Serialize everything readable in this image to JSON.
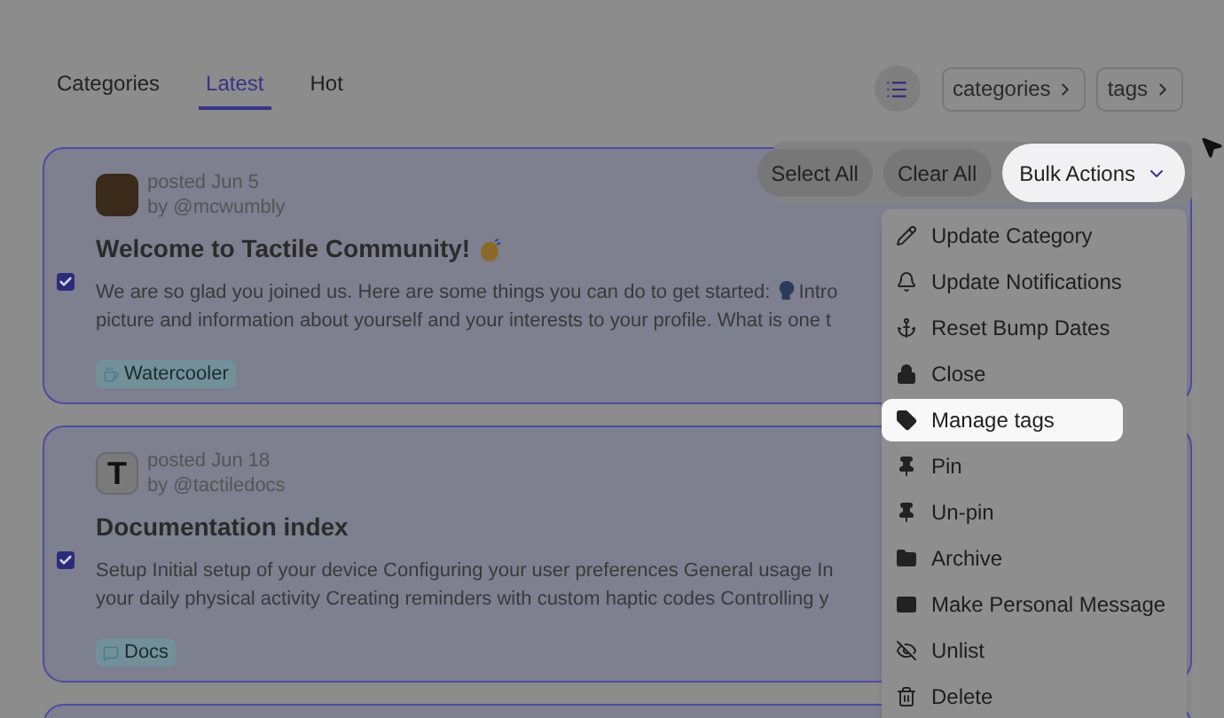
{
  "tabs": [
    {
      "label": "Categories",
      "selected": false
    },
    {
      "label": "Latest",
      "selected": true
    },
    {
      "label": "Hot",
      "selected": false
    }
  ],
  "breadcrumbs": [
    "categories",
    "tags"
  ],
  "bulk_bar": {
    "buttons": [
      {
        "label": "Select All",
        "highlighted": false
      },
      {
        "label": "Clear All",
        "highlighted": false
      },
      {
        "label": "Bulk Actions",
        "highlighted": true,
        "kind": "dropdown"
      }
    ]
  },
  "topics": [
    {
      "posted": "posted Jun 5",
      "author": "by @mcwumbly",
      "avatar": {
        "kind": "photo"
      },
      "title": "Welcome to Tactile Community!",
      "body": [
        "We are so glad you joined us. Here are some things you can do to get started:",
        "Intro\npicture and information about yourself and your interests to your profile. What is one t"
      ],
      "checked": true,
      "tag": {
        "label": "Watercooler"
      }
    },
    {
      "posted": "posted Jun 18",
      "author": "by @tactiledocs",
      "avatar": {
        "kind": "letter",
        "text": "T"
      },
      "title": "Documentation index",
      "body": [
        "Setup Initial setup of your device Configuring your user preferences General usage In\nyour daily physical activity Creating reminders with custom haptic codes Controlling y"
      ],
      "checked": true,
      "tag": {
        "label": "Docs"
      }
    }
  ],
  "bulk_menu": [
    {
      "kind": "pencil",
      "label": "Update Category",
      "highlighted": false
    },
    {
      "kind": "bell",
      "label": "Update Notifications",
      "highlighted": false
    },
    {
      "kind": "anchor",
      "label": "Reset Bump Dates",
      "highlighted": false
    },
    {
      "kind": "lock",
      "label": "Close",
      "highlighted": false
    },
    {
      "kind": "tag",
      "label": "Manage tags",
      "highlighted": true
    },
    {
      "kind": "pin",
      "label": "Pin",
      "highlighted": false
    },
    {
      "kind": "pin",
      "label": "Un-pin",
      "highlighted": false
    },
    {
      "kind": "folder",
      "label": "Archive",
      "highlighted": false
    },
    {
      "kind": "mail",
      "label": "Make Personal Message",
      "highlighted": false
    },
    {
      "kind": "eye-off",
      "label": "Unlist",
      "highlighted": false
    },
    {
      "kind": "trash",
      "label": "Delete",
      "highlighted": false
    }
  ]
}
